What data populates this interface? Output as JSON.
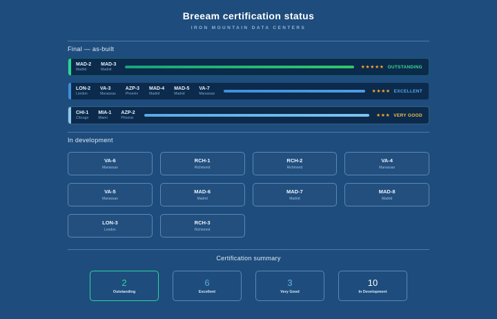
{
  "theme": {
    "background": "#1e4c7c",
    "panel": "#0b2a4c",
    "star_color": "#f6a72b"
  },
  "header": {
    "title": "Breeam certification status",
    "subtitle": "Iron Mountain Data Centers"
  },
  "final_section": {
    "label": "Final — as-built",
    "rows": [
      {
        "rating_label": "OUTSTANDING",
        "rating_color": "#3ddc8e",
        "stars": 5,
        "accent": "#2dd49e",
        "bar_from": "#16a57a",
        "bar_to": "#31c869",
        "facilities": [
          {
            "code": "MAD-2",
            "city": "Madrid"
          },
          {
            "code": "MAD-3",
            "city": "Madrid"
          }
        ]
      },
      {
        "rating_label": "EXCELLENT",
        "rating_color": "#5aa7e8",
        "stars": 4,
        "accent": "#3f8fd8",
        "bar_from": "#3f8fd8",
        "bar_to": "#4f9de2",
        "facilities": [
          {
            "code": "LON-2",
            "city": "London"
          },
          {
            "code": "VA-3",
            "city": "Manassas"
          },
          {
            "code": "AZP-3",
            "city": "Phoenix"
          },
          {
            "code": "MAD-4",
            "city": "Madrid"
          },
          {
            "code": "MAD-5",
            "city": "Madrid"
          },
          {
            "code": "VA-7",
            "city": "Manassas"
          }
        ]
      },
      {
        "rating_label": "VERY GOOD",
        "rating_color": "#f2c14e",
        "stars": 3,
        "accent": "#8ec9ee",
        "bar_from": "#5caae2",
        "bar_to": "#7fc4ef",
        "facilities": [
          {
            "code": "CHI-1",
            "city": "Chicago"
          },
          {
            "code": "MIA-1",
            "city": "Miami"
          },
          {
            "code": "AZP-2",
            "city": "Phoenix"
          }
        ]
      }
    ]
  },
  "development_section": {
    "label": "In development",
    "cards": [
      {
        "code": "VA-6",
        "city": "Manassas"
      },
      {
        "code": "RCH-1",
        "city": "Richmond"
      },
      {
        "code": "RCH-2",
        "city": "Richmond"
      },
      {
        "code": "VA-4",
        "city": "Manassas"
      },
      {
        "code": "VA-5",
        "city": "Manassas"
      },
      {
        "code": "MAD-6",
        "city": "Madrid"
      },
      {
        "code": "MAD-7",
        "city": "Madrid"
      },
      {
        "code": "MAD-8",
        "city": "Madrid"
      },
      {
        "code": "LON-3",
        "city": "London"
      },
      {
        "code": "RCH-3",
        "city": "Richmond"
      }
    ]
  },
  "summary_section": {
    "label": "Certification summary",
    "cards": [
      {
        "count": "2",
        "label": "Outstanding",
        "color": "#2fd6a4",
        "border": "#2fd6a4"
      },
      {
        "count": "6",
        "label": "Excellent",
        "color": "#5aa7e8",
        "border": "#8cb9e190"
      },
      {
        "count": "3",
        "label": "Very Good",
        "color": "#63b4ea",
        "border": "#8cb9e190"
      },
      {
        "count": "10",
        "label": "In Development",
        "color": "#ffffff",
        "border": "#8cb9e190"
      }
    ]
  }
}
